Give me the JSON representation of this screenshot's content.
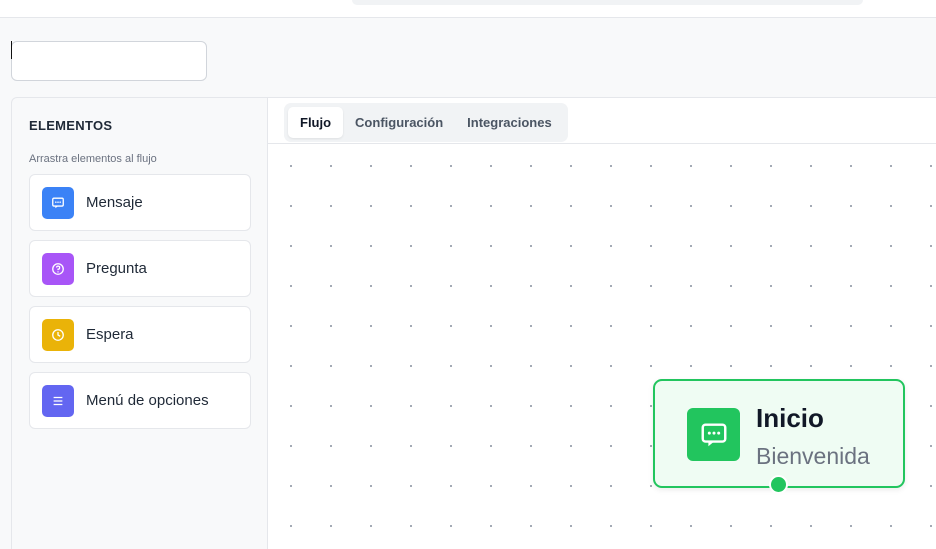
{
  "name_input": {
    "value": ""
  },
  "sidebar": {
    "title": "ELEMENTOS",
    "hint": "Arrastra elementos al flujo",
    "items": [
      {
        "label": "Mensaje",
        "icon": "message-icon",
        "color": "#3b82f6"
      },
      {
        "label": "Pregunta",
        "icon": "question-icon",
        "color": "#a855f7"
      },
      {
        "label": "Espera",
        "icon": "clock-icon",
        "color": "#eab308"
      },
      {
        "label": "Menú de opciones",
        "icon": "list-icon",
        "color": "#6366f1"
      }
    ]
  },
  "tabs": [
    {
      "label": "Flujo",
      "active": true
    },
    {
      "label": "Configuración",
      "active": false
    },
    {
      "label": "Integraciones",
      "active": false
    }
  ],
  "node": {
    "title": "Inicio",
    "subtitle": "Bienvenida",
    "icon": "message-icon",
    "color": "#22c55e"
  }
}
